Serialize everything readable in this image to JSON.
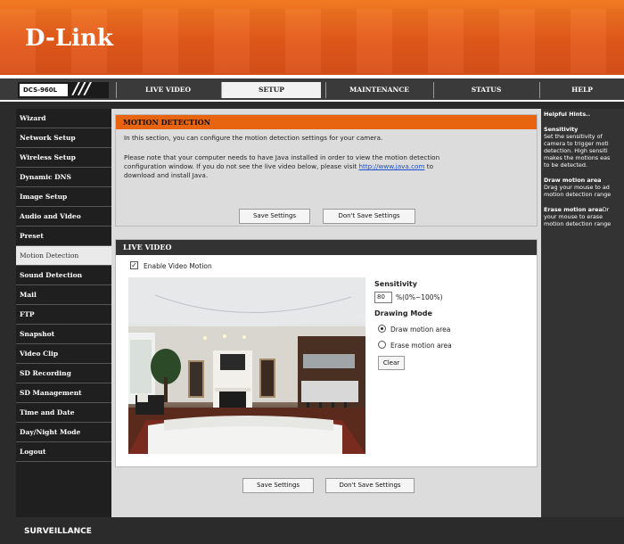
{
  "header": {
    "logo": "D-Link",
    "model": "DCS-960L",
    "slashes": "///"
  },
  "nav": {
    "tabs": [
      {
        "label": "LIVE VIDEO",
        "active": false
      },
      {
        "label": "SETUP",
        "active": true
      },
      {
        "label": "MAINTENANCE",
        "active": false
      },
      {
        "label": "STATUS",
        "active": false
      },
      {
        "label": "HELP",
        "active": false
      }
    ]
  },
  "sidebar": {
    "items": [
      {
        "label": "Wizard"
      },
      {
        "label": "Network Setup"
      },
      {
        "label": "Wireless Setup"
      },
      {
        "label": "Dynamic DNS"
      },
      {
        "label": "Image Setup"
      },
      {
        "label": "Audio and Video"
      },
      {
        "label": "Preset"
      },
      {
        "label": "Motion Detection",
        "active": true
      },
      {
        "label": "Sound Detection"
      },
      {
        "label": "Mail"
      },
      {
        "label": "FTP"
      },
      {
        "label": "Snapshot"
      },
      {
        "label": "Video Clip"
      },
      {
        "label": "SD Recording"
      },
      {
        "label": "SD Management"
      },
      {
        "label": "Time and Date"
      },
      {
        "label": "Day/Night Mode"
      },
      {
        "label": "Logout"
      }
    ]
  },
  "motion": {
    "title": "MOTION DETECTION",
    "intro": "In this section, you can configure the motion detection settings for your camera.",
    "java_note_1": "Please note that your computer needs to have Java installed in order to view the motion detection",
    "java_note_2": "configuration window. If you do not see the live video below, please visit",
    "java_link": "http://www.java.com",
    "java_note_3": "to",
    "java_note_4": "download and install Java.",
    "save_label": "Save Settings",
    "dont_save_label": "Don't Save Settings"
  },
  "live_video": {
    "title": "LIVE VIDEO",
    "enable_label": "Enable Video Motion",
    "enable_checked": true,
    "sensitivity_label": "Sensitivity",
    "sensitivity_value": "80",
    "sensitivity_range": "%(0%~100%)",
    "drawing_mode_label": "Drawing Mode",
    "draw_label": "Draw motion area",
    "erase_label": "Erase motion area",
    "draw_selected": true,
    "clear_label": "Clear"
  },
  "bottom_buttons": {
    "save_label": "Save Settings",
    "dont_save_label": "Don't Save Settings"
  },
  "hints": {
    "title": "Helpful Hints..",
    "s1_title": "Sensitivity",
    "s1_lines": [
      "Set the sensitivity of",
      "camera to trigger moti",
      "detection. High sensiti",
      "makes the motions eas",
      "to be detected."
    ],
    "s2_title": "Draw motion area",
    "s2_lines": [
      "Drag your mouse to ad",
      "motion detection range"
    ],
    "s3_title": "Erase motion area",
    "s3_suffix": "Dr",
    "s3_lines": [
      "your mouse to erase",
      "motion detection range"
    ]
  },
  "footer": {
    "text": "SURVEILLANCE"
  },
  "colors": {
    "brand_orange": "#e4591a",
    "panel_title_orange": "#e8640f",
    "dark": "#333333"
  }
}
